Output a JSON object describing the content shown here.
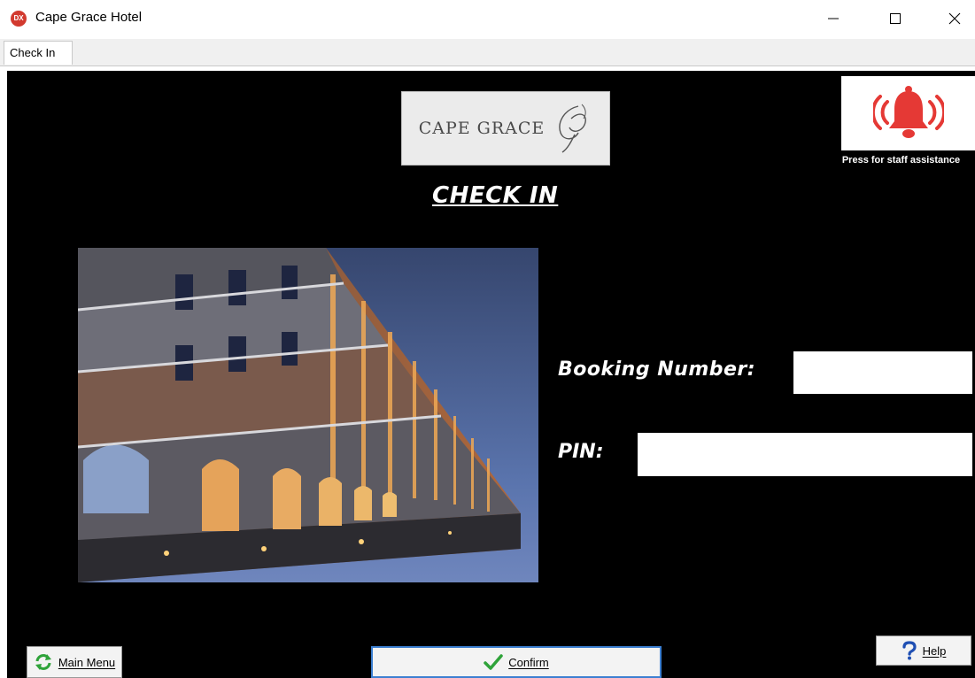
{
  "window": {
    "title": "Cape Grace Hotel",
    "icon_text": "DX",
    "icons": {
      "minimize": "minimize-icon",
      "maximize": "maximize-icon",
      "close": "close-icon"
    }
  },
  "tabs": [
    {
      "label": "Check In",
      "active": true
    }
  ],
  "branding": {
    "logo_text": "CAPE GRACE"
  },
  "page": {
    "heading": "CHECK IN"
  },
  "staff_assist": {
    "label": "Press for staff assistance",
    "icon": "alarm-bell-icon",
    "icon_color": "#e53935"
  },
  "form": {
    "booking": {
      "label": "Booking Number:",
      "value": ""
    },
    "pin": {
      "label": "PIN:",
      "value": ""
    }
  },
  "buttons": {
    "main_menu": {
      "label": "Main Menu",
      "icon": "refresh-icon",
      "icon_color": "#2fa33a"
    },
    "confirm": {
      "label": "Confirm",
      "icon": "checkmark-icon",
      "icon_color": "#2fa33a"
    },
    "help": {
      "label": "Help",
      "icon": "question-icon",
      "icon_color": "#1f4fb3"
    }
  },
  "colors": {
    "background": "#000000",
    "accent": "#3c7fd1"
  }
}
